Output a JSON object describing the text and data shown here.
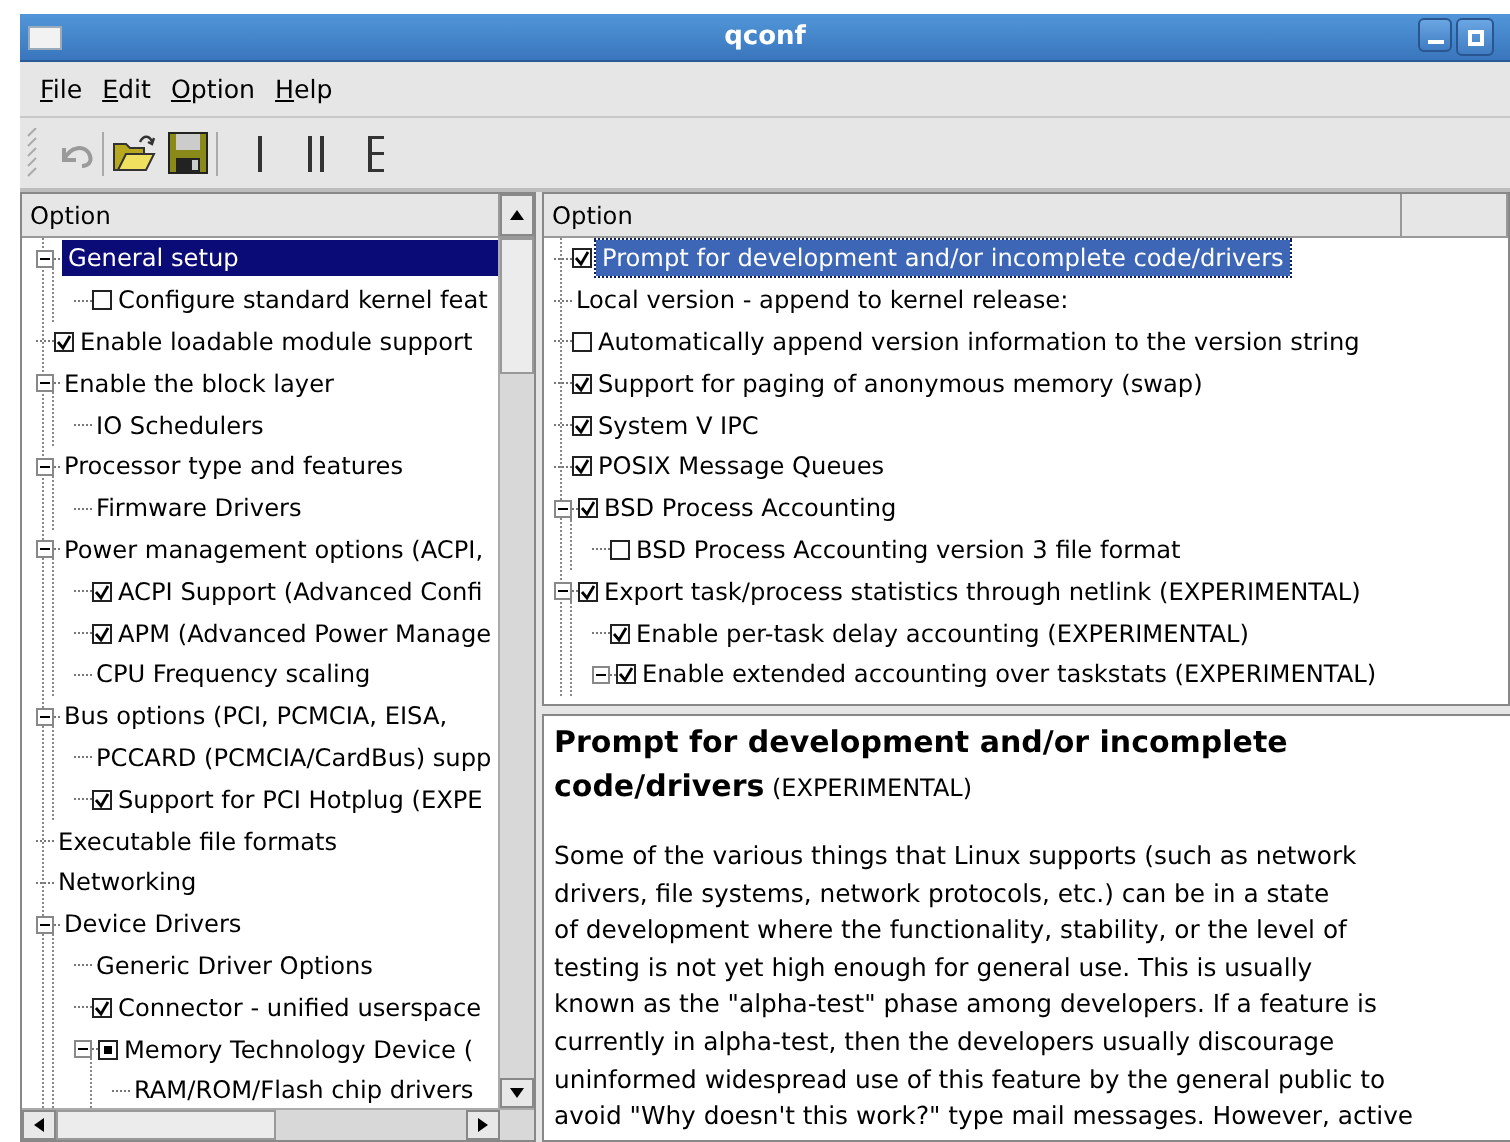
{
  "window": {
    "title": "qconf"
  },
  "menu": [
    "File",
    "Edit",
    "Option",
    "Help"
  ],
  "left_panel": {
    "header": "Option",
    "items": [
      {
        "label": "General setup",
        "kind": "menu",
        "selected": true,
        "expanded": true,
        "children": [
          {
            "label": "Configure standard kernel feat",
            "kind": "checkbox",
            "checked": false,
            "selected": false
          }
        ]
      },
      {
        "label": "Enable loadable module support",
        "kind": "checkbox",
        "checked": true,
        "selected": false
      },
      {
        "label": "Enable the block layer",
        "kind": "menu",
        "selected": false,
        "expanded": true,
        "children": [
          {
            "label": "IO Schedulers",
            "kind": "menu",
            "selected": false
          }
        ]
      },
      {
        "label": "Processor type and features",
        "kind": "menu",
        "selected": false,
        "expanded": true,
        "children": [
          {
            "label": "Firmware Drivers",
            "kind": "menu",
            "selected": false
          }
        ]
      },
      {
        "label": "Power management options (ACPI,",
        "kind": "menu",
        "selected": false,
        "expanded": true,
        "children": [
          {
            "label": "ACPI Support (Advanced Confi",
            "kind": "checkbox",
            "checked": true,
            "selected": false
          },
          {
            "label": "APM (Advanced Power Manage",
            "kind": "checkbox",
            "checked": true,
            "selected": false
          },
          {
            "label": "CPU Frequency scaling",
            "kind": "menu",
            "selected": false
          }
        ]
      },
      {
        "label": "Bus options (PCI, PCMCIA, EISA,",
        "kind": "menu",
        "selected": false,
        "expanded": true,
        "children": [
          {
            "label": "PCCARD (PCMCIA/CardBus) supp",
            "kind": "menu",
            "selected": false
          },
          {
            "label": "Support for PCI Hotplug (EXPE",
            "kind": "checkbox",
            "checked": true,
            "selected": false
          }
        ]
      },
      {
        "label": "Executable file formats",
        "kind": "menu",
        "selected": false
      },
      {
        "label": "Networking",
        "kind": "menu",
        "selected": false
      },
      {
        "label": "Device Drivers",
        "kind": "menu",
        "selected": false,
        "expanded": true,
        "children": [
          {
            "label": "Generic Driver Options",
            "kind": "menu",
            "selected": false
          },
          {
            "label": "Connector - unified userspace",
            "kind": "checkbox",
            "checked": true,
            "selected": false
          },
          {
            "label": "Memory Technology Device (",
            "kind": "module",
            "checked": true,
            "selected": false,
            "expanded": true,
            "children": [
              {
                "label": "RAM/ROM/Flash chip drivers",
                "kind": "menu",
                "selected": false
              }
            ]
          }
        ]
      }
    ]
  },
  "right_panel": {
    "header": "Option",
    "items": [
      {
        "label": "Prompt for development and/or incomplete code/drivers",
        "kind": "checkbox",
        "checked": true,
        "selected": true
      },
      {
        "label": "Local version - append to kernel release:",
        "kind": "menu",
        "selected": false
      },
      {
        "label": "Automatically append version information to the version string",
        "kind": "checkbox",
        "checked": false,
        "selected": false
      },
      {
        "label": "Support for paging of anonymous memory (swap)",
        "kind": "checkbox",
        "checked": true,
        "selected": false
      },
      {
        "label": "System V IPC",
        "kind": "checkbox",
        "checked": true,
        "selected": false
      },
      {
        "label": "POSIX Message Queues",
        "kind": "checkbox",
        "checked": true,
        "selected": false
      },
      {
        "label": "BSD Process Accounting",
        "kind": "checkbox",
        "checked": true,
        "selected": false,
        "expanded": true,
        "children": [
          {
            "label": "BSD Process Accounting version 3 file format",
            "kind": "checkbox",
            "checked": false,
            "selected": false
          }
        ]
      },
      {
        "label": "Export task/process statistics through netlink (EXPERIMENTAL)",
        "kind": "checkbox",
        "checked": true,
        "selected": false,
        "expanded": true,
        "children": [
          {
            "label": "Enable per-task delay accounting (EXPERIMENTAL)",
            "kind": "checkbox",
            "checked": true,
            "selected": false
          },
          {
            "label": "Enable extended accounting over taskstats (EXPERIMENTAL)",
            "kind": "checkbox",
            "checked": true,
            "selected": false,
            "expanded": true
          }
        ]
      }
    ]
  },
  "info": {
    "title": "**Prompt for development and/or incomplete code/drivers** (EXPERIMENTAL)",
    "lines": [
      "Some of the various things that Linux supports (such as network",
      "drivers, file systems, network protocols, etc.) can be in a state",
      "of development where the functionality, stability, or the level of",
      "testing is not yet high enough for general use. This is usually",
      "known as the \"alpha-test\" phase among developers. If a feature is",
      "currently in alpha-test, then the developers usually discourage",
      "uninformed widespread use of this feature by the general public to",
      "avoid \"Why doesn't this work?\" type mail messages. However, active"
    ]
  }
}
